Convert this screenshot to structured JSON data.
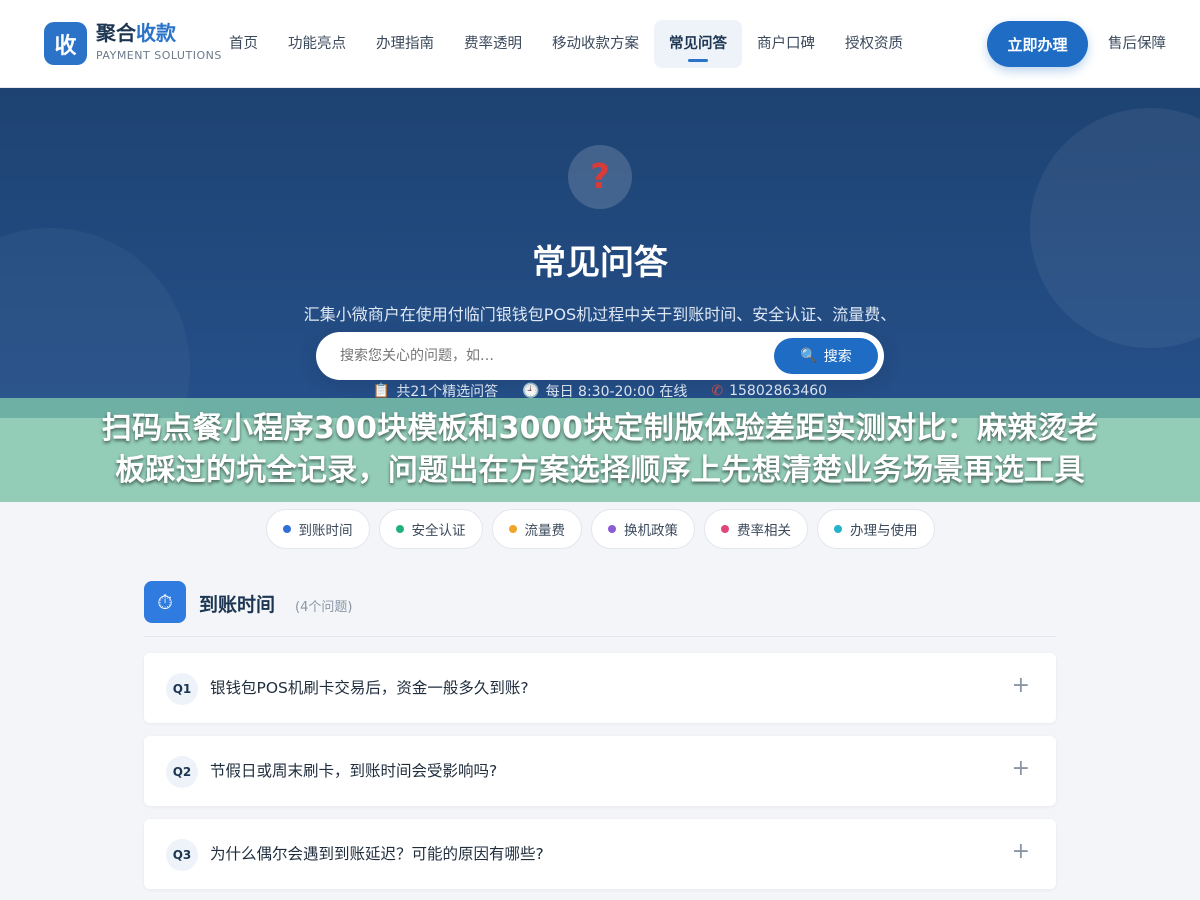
{
  "header": {
    "logo_glyph": "收",
    "brand_main": "聚合",
    "brand_accent": "收款",
    "brand_sub": "PAYMENT SOLUTIONS",
    "nav": [
      {
        "label": "首页",
        "active": false
      },
      {
        "label": "功能亮点",
        "active": false
      },
      {
        "label": "办理指南",
        "active": false
      },
      {
        "label": "费率透明",
        "active": false
      },
      {
        "label": "移动收款方案",
        "active": false
      },
      {
        "label": "常见问答",
        "active": true
      },
      {
        "label": "商户口碑",
        "active": false
      },
      {
        "label": "授权资质",
        "active": false
      }
    ],
    "cta_label": "立即办理",
    "nav_after": "售后保障"
  },
  "hero": {
    "icon_glyph": "?",
    "title": "常见问答",
    "description": "汇集小微商户在使用付临门银钱包POS机过程中关于到账时间、安全认证、流量费、换机政策等高频问题解答，消除您的收款疑虑，让每一笔交易都安心透明。",
    "meta": {
      "count_text": "共21个精选问答",
      "hours_text": "每日 8:30-20:00 在线",
      "phone_text": "15802863460"
    },
    "search": {
      "placeholder": "搜索您关心的问题，如…",
      "button_label": "搜索"
    }
  },
  "banner": {
    "line1": "扫码点餐小程序300块模板和3000块定制版体验差距实测对比：麻辣烫老",
    "line2": "板踩过的坑全记录，问题出在方案选择顺序上先想清楚业务场景再选工具"
  },
  "categories": [
    {
      "label": "到账时间",
      "color": "#2f6fd6"
    },
    {
      "label": "安全认证",
      "color": "#22b07d"
    },
    {
      "label": "流量费",
      "color": "#f0a52a"
    },
    {
      "label": "换机政策",
      "color": "#8a5cd6"
    },
    {
      "label": "费率相关",
      "color": "#e0467a"
    },
    {
      "label": "办理与使用",
      "color": "#25b3c9"
    }
  ],
  "section": {
    "title": "到账时间",
    "count": "(4个问题)",
    "questions": [
      {
        "badge": "Q1",
        "text": "银钱包POS机刷卡交易后，资金一般多久到账?"
      },
      {
        "badge": "Q2",
        "text": "节假日或周末刷卡，到账时间会受影响吗?"
      },
      {
        "badge": "Q3",
        "text": "为什么偶尔会遇到到账延迟？可能的原因有哪些?"
      }
    ]
  },
  "colors": {
    "brand": "#2a73c9",
    "hero_bg": "#1e4372",
    "cta": "#1f6cc4",
    "banner": "#7ec4aa"
  }
}
